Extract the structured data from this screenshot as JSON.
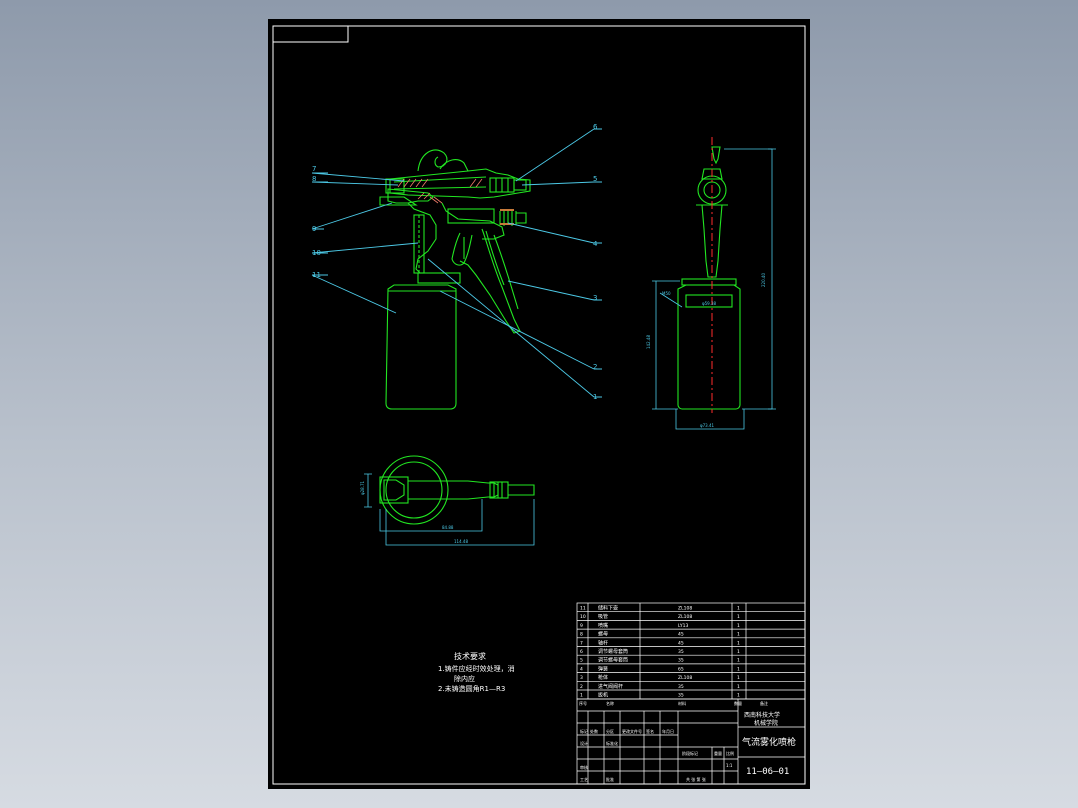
{
  "drawing": {
    "balloons": {
      "n6": "6",
      "n7": "7",
      "n8": "8",
      "n5": "5",
      "n9": "9",
      "n4": "4",
      "n10": "10",
      "n11": "11",
      "n3": "3",
      "n2": "2",
      "n1": "1"
    },
    "tech_requirements": {
      "heading": "技术要求",
      "line1": "1.铸件应经时效处理，消",
      "line2": "除内应",
      "line3": "2.未铸造圆角R1—R3"
    }
  },
  "bom": {
    "rows": [
      {
        "no": "11",
        "name": "储料下壶",
        "material": "ZL108",
        "qty": "1"
      },
      {
        "no": "10",
        "name": "吸管",
        "material": "ZL108",
        "qty": "1"
      },
      {
        "no": "9",
        "name": "喷嘴",
        "material": "LY13",
        "qty": "1"
      },
      {
        "no": "8",
        "name": "螺母",
        "material": "45",
        "qty": "1"
      },
      {
        "no": "7",
        "name": "轴杆",
        "material": "45",
        "qty": "1"
      },
      {
        "no": "6",
        "name": "调节螺母套筒",
        "material": "35",
        "qty": "1"
      },
      {
        "no": "5",
        "name": "调节螺母套筒",
        "material": "35",
        "qty": "1"
      },
      {
        "no": "4",
        "name": "弹簧",
        "material": "65",
        "qty": "1"
      },
      {
        "no": "3",
        "name": "枪体",
        "material": "ZL108",
        "qty": "1"
      },
      {
        "no": "2",
        "name": "进气阀阀杆",
        "material": "35",
        "qty": "1"
      },
      {
        "no": "1",
        "name": "扳机",
        "material": "35",
        "qty": "1"
      }
    ],
    "header": {
      "no": "序号",
      "name": "名称",
      "material": "材料",
      "qty": "数量",
      "note": "备注"
    }
  },
  "title_block": {
    "school": "西南科技大学",
    "school2": "机械学院",
    "drawing_title": "气流雾化喷枪",
    "drawing_number": "11—06—01",
    "scale_label": "比例",
    "scale_value": "1:1",
    "sheet_label": "共 张 第 张",
    "designer": "设计",
    "checker": "审核",
    "process": "工艺",
    "standard": "标准化",
    "approve": "批准",
    "stage": "阶段标记",
    "weight": "重量",
    "mark": "标记",
    "count": "处数",
    "zone": "分区",
    "change": "更改文件号",
    "sign": "签名",
    "date": "年月日"
  }
}
